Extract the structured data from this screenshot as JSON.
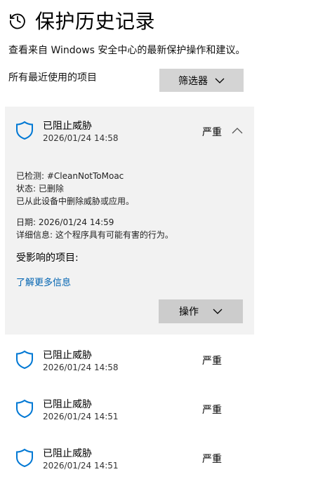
{
  "header": {
    "title": "保护历史记录",
    "subtitle": "查看来自 Windows 安全中心的最新保护操作和建议。"
  },
  "filter": {
    "label": "所有最近使用的项目",
    "button_label": "筛选器"
  },
  "expanded_item": {
    "title": "已阻止威胁",
    "time": "2026/01/24 14:58",
    "severity": "严重",
    "detected": "已检测:  #CleanNotToMoac",
    "status": "状态: 已删除",
    "action_text": "已从此设备中删除威胁或应用。",
    "date": "日期:  2026/01/24 14:59",
    "details": "详细信息:  这个程序具有可能有害的行为。",
    "affected_label": "受影响的项目:",
    "learn_more": "了解更多信息",
    "action_button": "操作"
  },
  "items": [
    {
      "title": "已阻止威胁",
      "time": "2026/01/24 14:58",
      "severity": "严重"
    },
    {
      "title": "已阻止威胁",
      "time": "2026/01/24 14:51",
      "severity": "严重"
    },
    {
      "title": "已阻止威胁",
      "time": "2026/01/24 14:51",
      "severity": "严重"
    }
  ],
  "colors": {
    "accent": "#0063b1",
    "shield": "#0078d4",
    "card_bg": "#f2f2f2",
    "button_bg": "#d4d4d4"
  }
}
